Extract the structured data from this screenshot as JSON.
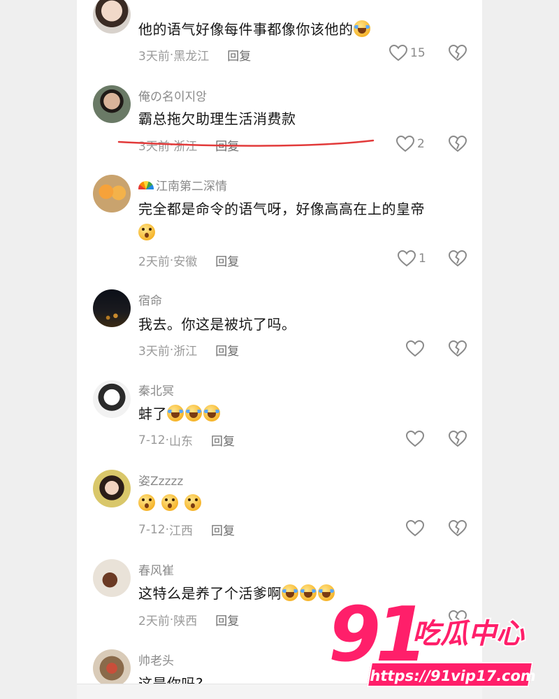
{
  "colors": {
    "username": "#8a8a8a",
    "text": "#161616",
    "meta": "#9a9a9a",
    "watermark": "#ff1f6a"
  },
  "comments": [
    {
      "username": "",
      "text": "他的语气好像每件事都像你该他的",
      "emoji": [
        "cry"
      ],
      "time": "3天前",
      "location": "黑龙江",
      "reply": "回复",
      "likes": "15"
    },
    {
      "username": "俺の名이지앙",
      "text": "霸总拖欠助理生活消费款",
      "emoji": [],
      "time": "3天前",
      "location": "浙江",
      "reply": "回复",
      "likes": "2"
    },
    {
      "username": "江南第二深情",
      "text": "完全都是命令的语气呀，好像高高在上的皇帝",
      "emoji": [
        "wow"
      ],
      "time": "2天前",
      "location": "安徽",
      "reply": "回复",
      "likes": "1"
    },
    {
      "username": "宿命",
      "text": "我去。你这是被坑了吗。",
      "emoji": [],
      "time": "3天前",
      "location": "浙江",
      "reply": "回复",
      "likes": ""
    },
    {
      "username": "秦北冥",
      "text": "蚌了",
      "emoji": [
        "cry",
        "cry",
        "cry"
      ],
      "time": "7-12",
      "location": "山东",
      "reply": "回复",
      "likes": ""
    },
    {
      "username": "姿Zzzzz",
      "text": "",
      "emoji": [
        "wow",
        "wow",
        "wow"
      ],
      "time": "7-12",
      "location": "江西",
      "reply": "回复",
      "likes": ""
    },
    {
      "username": "春风崔",
      "text": "这特么是养了个活爹啊",
      "emoji": [
        "cry",
        "cry",
        "cry"
      ],
      "time": "2天前",
      "location": "陕西",
      "reply": "回复",
      "likes": ""
    },
    {
      "username": "帅老头",
      "text": "这是你吗?",
      "emoji": [],
      "time": "",
      "location": "",
      "reply": "",
      "likes": ""
    }
  ],
  "watermark": {
    "brand": "91",
    "name": "吃瓜中心",
    "url": "https://91vip17.com"
  }
}
